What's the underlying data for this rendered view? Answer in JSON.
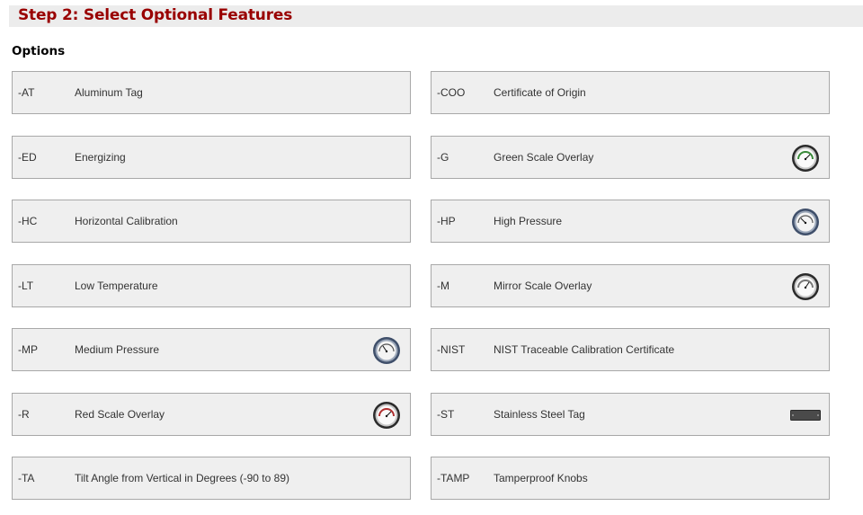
{
  "step": {
    "title": "Step 2: Select Optional Features"
  },
  "section": {
    "title": "Options"
  },
  "options": [
    {
      "code": "-AT",
      "label": "Aluminum Tag",
      "image": "none"
    },
    {
      "code": "-COO",
      "label": "Certificate of Origin",
      "image": "none"
    },
    {
      "code": "-ED",
      "label": "Energizing",
      "image": "none"
    },
    {
      "code": "-G",
      "label": "Green Scale Overlay",
      "image": "gauge-icon"
    },
    {
      "code": "-HC",
      "label": "Horizontal Calibration",
      "image": "none"
    },
    {
      "code": "-HP",
      "label": "High Pressure",
      "image": "gauge-icon"
    },
    {
      "code": "-LT",
      "label": "Low Temperature",
      "image": "none"
    },
    {
      "code": "-M",
      "label": "Mirror Scale Overlay",
      "image": "gauge-icon"
    },
    {
      "code": "-MP",
      "label": "Medium Pressure",
      "image": "gauge-icon"
    },
    {
      "code": "-NIST",
      "label": "NIST Traceable Calibration Certificate",
      "image": "none"
    },
    {
      "code": "-R",
      "label": "Red Scale Overlay",
      "image": "gauge-icon"
    },
    {
      "code": "-ST",
      "label": "Stainless Steel Tag",
      "image": "tag-icon"
    },
    {
      "code": "-TA",
      "label": "Tilt Angle from Vertical in Degrees (-90 to 89)",
      "image": "none"
    },
    {
      "code": "-TAMP",
      "label": "Tamperproof Knobs",
      "image": "none"
    }
  ],
  "colors": {
    "header_text": "#990000",
    "header_bar": "#ececec",
    "option_bg": "#efefef",
    "option_border": "#a8a8a8"
  }
}
